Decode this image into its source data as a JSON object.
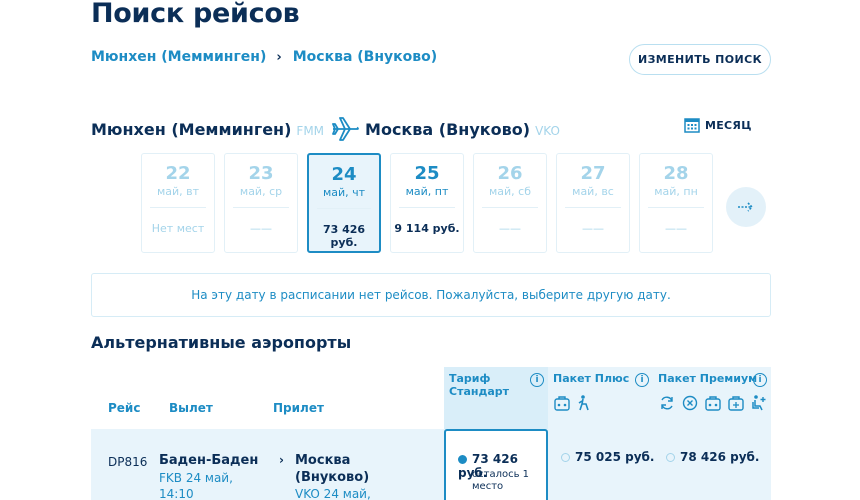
{
  "page": {
    "title": "Поиск рейсов"
  },
  "breadcrumb": {
    "from": "Мюнхен (Мемминген)",
    "separator": "›",
    "to": "Москва (Внуково)"
  },
  "actions": {
    "change_search": "ИЗМЕНИТЬ ПОИСК",
    "month": "МЕСЯЦ"
  },
  "route": {
    "from": "Мюнхен (Мемминген)",
    "from_code": "FMM",
    "to": "Москва (Внуково)",
    "to_code": "VKO"
  },
  "dates": [
    {
      "day": "22",
      "dow": "май, вт",
      "price": "Нет мест",
      "state": "disabled"
    },
    {
      "day": "23",
      "dow": "май, ср",
      "price": "——",
      "state": "disabled"
    },
    {
      "day": "24",
      "dow": "май, чт",
      "price": "73 426 руб.",
      "state": "active"
    },
    {
      "day": "25",
      "dow": "май, пт",
      "price": "9 114 руб.",
      "state": "strong"
    },
    {
      "day": "26",
      "dow": "май, сб",
      "price": "——",
      "state": "disabled"
    },
    {
      "day": "27",
      "dow": "май, вс",
      "price": "——",
      "state": "disabled"
    },
    {
      "day": "28",
      "dow": "май, пн",
      "price": "——",
      "state": "disabled"
    }
  ],
  "notice": "На эту дату в расписании нет рейсов. Пожалуйста, выберите другую дату.",
  "alt_section": {
    "title": "Альтернативные аэропорты"
  },
  "table": {
    "headers": {
      "flight": "Рейс",
      "departure": "Вылет",
      "arrival": "Прилет"
    },
    "tariffs": [
      {
        "name": "Тариф Стандарт"
      },
      {
        "name": "Пакет Плюс"
      },
      {
        "name": "Пакет Премиум"
      }
    ],
    "rows": [
      {
        "flight": "DP816",
        "dep_city": "Баден-Баден",
        "dep_detail": "FKB 24 май,",
        "dep_time": "14:10",
        "arr_city": "Москва",
        "arr_city2": "(Внуково)",
        "arr_detail": "VKO 24 май,",
        "fare_standard": "73 426 руб.",
        "fare_standard_note": "осталось 1",
        "fare_standard_note2": "место",
        "fare_plus": "75 025 руб.",
        "fare_premium": "78 426 руб."
      }
    ]
  },
  "colors": {
    "accent": "#1d8cc4",
    "dark": "#0b2e57",
    "light": "#a4d4ea",
    "highlight": "#d9eef9"
  }
}
